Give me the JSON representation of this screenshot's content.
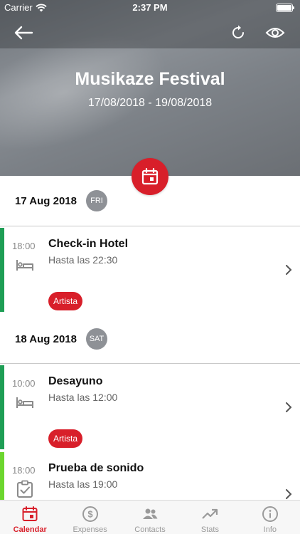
{
  "status_bar": {
    "carrier": "Carrier",
    "time": "2:37 PM"
  },
  "event": {
    "title": "Musikaze Festival",
    "dates": "17/08/2018 - 19/08/2018"
  },
  "colors": {
    "accent": "#d81f2a",
    "stripe_green": "#1e9e55",
    "stripe_lime": "#6cd62e"
  },
  "days": [
    {
      "date": "17 Aug 2018",
      "weekday": "FRI",
      "items": [
        {
          "time": "18:00",
          "title": "Check-in Hotel",
          "subtitle": "Hasta las 22:30",
          "tag": "Artista",
          "icon": "bed-icon"
        }
      ]
    },
    {
      "date": "18 Aug 2018",
      "weekday": "SAT",
      "items": [
        {
          "time": "10:00",
          "title": "Desayuno",
          "subtitle": "Hasta las 12:00",
          "tag": "Artista",
          "icon": "bed-icon"
        },
        {
          "time": "18:00",
          "title": "Prueba de sonido",
          "subtitle": "Hasta las 19:00",
          "icon": "checklist-icon"
        }
      ]
    }
  ],
  "tabs": [
    {
      "label": "Calendar",
      "icon": "calendar-icon",
      "active": true
    },
    {
      "label": "Expenses",
      "icon": "dollar-icon"
    },
    {
      "label": "Contacts",
      "icon": "contacts-icon"
    },
    {
      "label": "Stats",
      "icon": "trending-up-icon"
    },
    {
      "label": "Info",
      "icon": "info-icon"
    }
  ]
}
